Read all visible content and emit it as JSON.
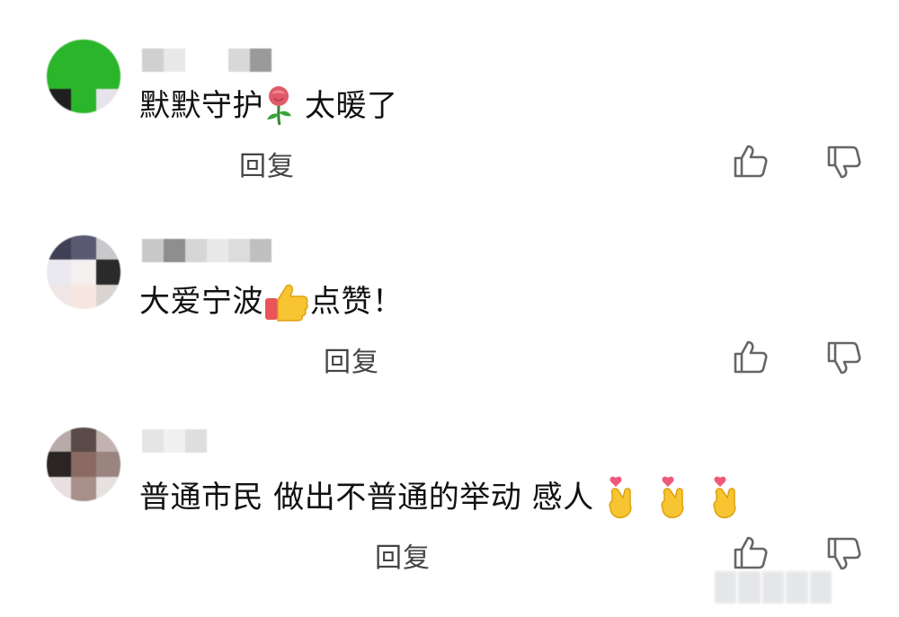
{
  "comments": [
    {
      "text_a": "默默守护",
      "text_b": "太暖了",
      "emoji_a": "rose-emoji",
      "reply_label": "回复",
      "avatar_colors": [
        "#2bb52b",
        "#2bb52b",
        "#2bb52b",
        "#2bb52b",
        "#2bb52b",
        "#2bb52b",
        "#1f1f1f",
        "#2bb52b",
        "#e6e3ea"
      ]
    },
    {
      "text_a": "大爱宁波",
      "text_b": "点赞！",
      "emoji_a": "thumbs-up-emoji",
      "reply_label": "回复",
      "avatar_colors": [
        "#3f3f55",
        "#5a5a72",
        "#c9c9cc",
        "#e9e9ef",
        "#f4f0f0",
        "#2a2a2a",
        "#f0e6e6",
        "#f6e6e0",
        "#d9d4d0"
      ]
    },
    {
      "text_a": "普通市民 做出不普通的举动 感人",
      "emoji_a": "finger-heart-emoji",
      "reply_label": "回复",
      "avatar_colors": [
        "#b8aaa8",
        "#5a4a48",
        "#c2b2b0",
        "#2a2424",
        "#8a6a62",
        "#9a8480",
        "#e8e0e0",
        "#a8908a",
        "#e6e0e0"
      ]
    }
  ],
  "icons": {
    "like": "thumbs-up-outline-icon",
    "dislike": "thumbs-down-outline-icon"
  },
  "colors": {
    "text": "#111111",
    "reply": "#444444",
    "icon": "#666666"
  }
}
